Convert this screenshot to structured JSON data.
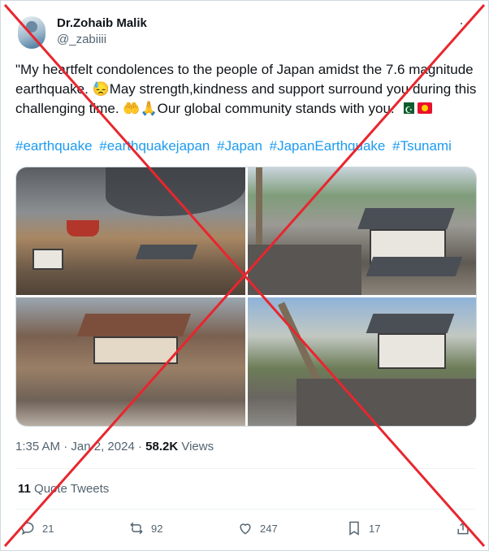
{
  "author": {
    "display_name": "Dr.Zohaib Malik",
    "handle": "@_zabiiii",
    "avatar_icon": "profile-avatar"
  },
  "more_icon": "more-icon",
  "tweet": {
    "text_part1": "\"My heartfelt condolences to the people of Japan amidst the 7.6 magnitude earthquake. ",
    "emoji1": "😓",
    "text_part2": "May strength,kindness and support surround you during this challenging time. ",
    "emoji2": "🤲🙏",
    "text_part3": "Our global community stands with you. ",
    "flags": [
      "pakistan-flag",
      "kyrgyzstan-flag"
    ],
    "hashtags": [
      "#earthquake",
      "#earthquakejapan",
      "#Japan",
      "#JapanEarthquake",
      "#Tsunami"
    ]
  },
  "media": [
    {
      "alt": "tsunami-debris-photo"
    },
    {
      "alt": "collapsed-houses-photo"
    },
    {
      "alt": "destroyed-house-rubble-photo"
    },
    {
      "alt": "damaged-street-people-photo"
    }
  ],
  "meta": {
    "time": "1:35 AM",
    "date": "Jan 2, 2024",
    "views_count": "58.2K",
    "views_label": "Views"
  },
  "quote_tweets": {
    "count": "11",
    "label": "Quote Tweets"
  },
  "actions": {
    "reply_count": "21",
    "retweet_count": "92",
    "like_count": "247",
    "bookmark_count": "17"
  },
  "overlay": {
    "type": "red-x-cross",
    "color": "#e8262e"
  },
  "colors": {
    "link": "#1d9bf0",
    "secondary_text": "#536471",
    "primary_text": "#0f1419",
    "border": "#cfd9de"
  }
}
